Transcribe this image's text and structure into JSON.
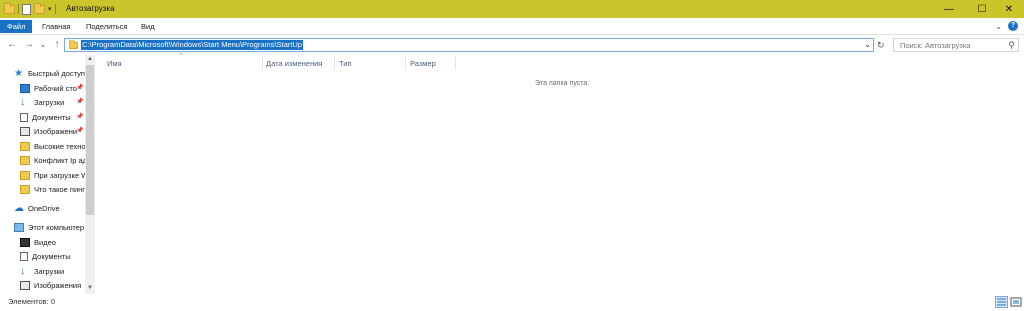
{
  "window": {
    "title": "Автозагрузка",
    "minimize_glyph": "—",
    "maximize_glyph": "☐",
    "close_glyph": "✕",
    "accent_color": "#c9c52b"
  },
  "ribbon": {
    "tabs": [
      {
        "label": "Файл"
      },
      {
        "label": "Главная"
      },
      {
        "label": "Поделиться"
      },
      {
        "label": "Вид"
      }
    ],
    "expand_glyph": "⌄",
    "help_glyph": "?"
  },
  "address": {
    "back_glyph": "←",
    "forward_glyph": "→",
    "recent_glyph": "⌄",
    "up_glyph": "↑",
    "path": "C:\\ProgramData\\Microsoft\\Windows\\Start Menu\\Programs\\StartUp",
    "dropdown_glyph": "⌄",
    "refresh_glyph": "↻"
  },
  "search": {
    "placeholder": "Поиск: Автозагрузка",
    "icon_glyph": "⚲"
  },
  "sidebar": {
    "quick_access": "Быстрый доступ",
    "items": [
      {
        "label": "Рабочий сто",
        "icon": "desktop-icon",
        "pinned": true
      },
      {
        "label": "Загрузки",
        "icon": "downloads-icon",
        "pinned": true
      },
      {
        "label": "Документы",
        "icon": "documents-icon",
        "pinned": true
      },
      {
        "label": "Изображени",
        "icon": "pictures-icon",
        "pinned": true
      },
      {
        "label": "Высокие техно",
        "icon": "folder-icon",
        "pinned": false
      },
      {
        "label": "Конфликт Ip адр",
        "icon": "folder-icon",
        "pinned": false
      },
      {
        "label": "При загрузке W",
        "icon": "folder-icon",
        "pinned": false
      },
      {
        "label": "Что такое пинг",
        "icon": "folder-icon",
        "pinned": false
      }
    ],
    "onedrive": "OneDrive",
    "this_pc": "Этот компьютер",
    "pc_items": [
      {
        "label": "Видео",
        "icon": "video-icon"
      },
      {
        "label": "Документы",
        "icon": "documents-icon"
      },
      {
        "label": "Загрузки",
        "icon": "downloads-icon"
      },
      {
        "label": "Изображения",
        "icon": "pictures-icon"
      }
    ],
    "pin_glyph": "📌",
    "scroll_up_glyph": "▲",
    "scroll_down_glyph": "▼"
  },
  "content": {
    "columns": [
      {
        "label": "Имя"
      },
      {
        "label": "Дата изменения"
      },
      {
        "label": "Тип"
      },
      {
        "label": "Размер"
      }
    ],
    "sort_glyph": "^",
    "empty_message": "Эта папка пуста."
  },
  "status": {
    "items_count": "Элементов: 0"
  }
}
